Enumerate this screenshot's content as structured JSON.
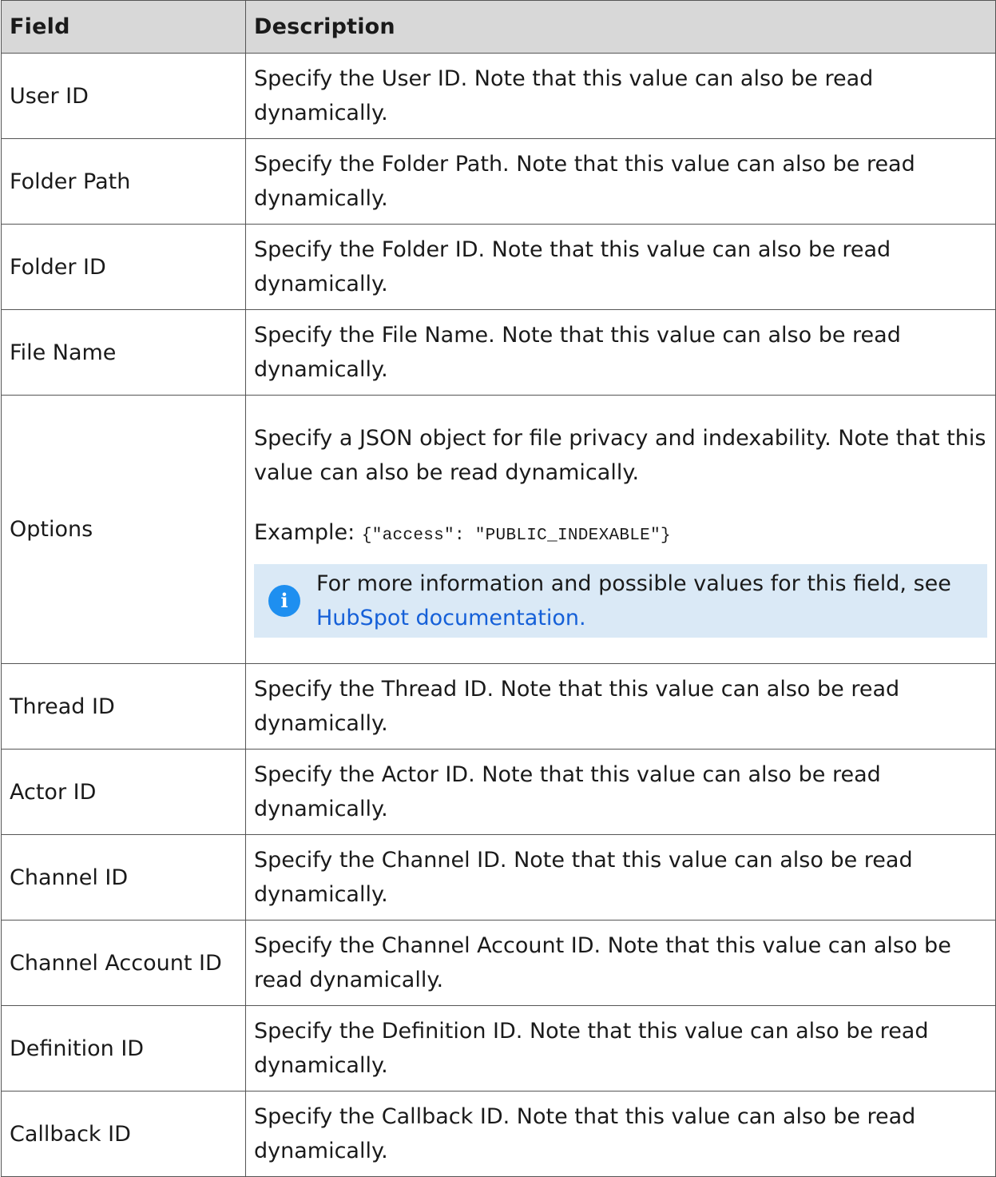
{
  "table": {
    "headers": {
      "field": "Field",
      "description": "Description"
    },
    "rows": [
      {
        "field": "User ID",
        "description": "Specify the User ID. Note that this value can also be read dynamically."
      },
      {
        "field": "Folder Path",
        "description": "Specify the Folder Path. Note that this value can also be read dynamically."
      },
      {
        "field": "Folder ID",
        "description": "Specify the Folder ID. Note that this value can also be read dynamically."
      },
      {
        "field": "File Name",
        "description": "Specify the File Name. Note that this value can also be read dynamically."
      },
      {
        "field": "Options",
        "description": "Specify a JSON object for file privacy and indexability. Note that this value can also be read dynamically.",
        "example_label": "Example:",
        "example_code": "{\"access\": \"PUBLIC_INDEXABLE\"}",
        "info": {
          "icon": "info-icon",
          "icon_glyph": "i",
          "text": "For more information and possible values for this field, see",
          "link": "HubSpot documentation."
        }
      },
      {
        "field": "Thread ID",
        "description": "Specify the Thread ID. Note that this value can also be read dynamically."
      },
      {
        "field": "Actor ID",
        "description": "Specify the Actor ID. Note that this value can also be read dynamically."
      },
      {
        "field": "Channel ID",
        "description": "Specify the Channel ID. Note that this value can also be read dynamically."
      },
      {
        "field": "Channel Account ID",
        "description": "Specify the Channel Account ID. Note that this value can also be read dynamically."
      },
      {
        "field": "Definition ID",
        "description": "Specify the Definition ID. Note that this value can also be read dynamically."
      },
      {
        "field": "Callback ID",
        "description": "Specify the Callback ID. Note that this value can also be read dynamically."
      }
    ]
  },
  "colors": {
    "header_bg": "#d8d8d8",
    "border": "#555555",
    "info_bg": "#dae9f6",
    "info_icon": "#1e8ff0",
    "link": "#1560d8"
  }
}
